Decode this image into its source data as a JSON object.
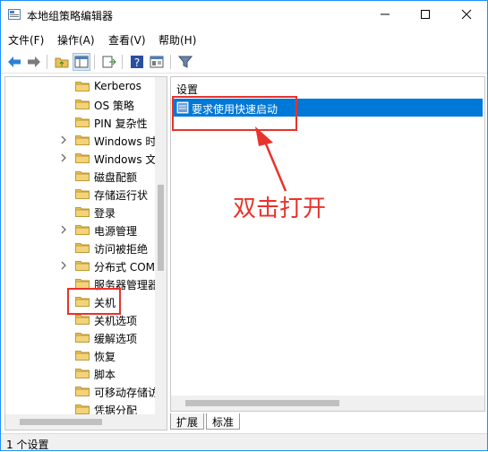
{
  "window": {
    "title": "本地组策略编辑器"
  },
  "menu": [
    "文件(F)",
    "操作(A)",
    "查看(V)",
    "帮助(H)"
  ],
  "toolbar": {
    "icons": [
      "back-arrow-icon",
      "forward-arrow-icon",
      "up-folder-icon",
      "show-hide-tree-icon",
      "export-list-icon",
      "help-icon",
      "properties-icon",
      "filter-icon"
    ]
  },
  "tree": {
    "items": [
      {
        "label": "Kerberos",
        "expandable": false
      },
      {
        "label": "OS 策略",
        "expandable": false
      },
      {
        "label": "PIN 复杂性",
        "expandable": false
      },
      {
        "label": "Windows 时",
        "expandable": true
      },
      {
        "label": "Windows 文",
        "expandable": true
      },
      {
        "label": "磁盘配额",
        "expandable": false
      },
      {
        "label": "存储运行状",
        "expandable": false
      },
      {
        "label": "登录",
        "expandable": false
      },
      {
        "label": "电源管理",
        "expandable": true
      },
      {
        "label": "访问被拒绝",
        "expandable": false
      },
      {
        "label": "分布式 COM",
        "expandable": true
      },
      {
        "label": "服务器管理器",
        "expandable": false
      },
      {
        "label": "关机",
        "expandable": false,
        "selected": true
      },
      {
        "label": "关机选项",
        "expandable": false
      },
      {
        "label": "缓解选项",
        "expandable": false
      },
      {
        "label": "恢复",
        "expandable": false
      },
      {
        "label": "脚本",
        "expandable": false
      },
      {
        "label": "可移动存储访",
        "expandable": false
      },
      {
        "label": "凭据分配",
        "expandable": false
      }
    ]
  },
  "right_pane": {
    "column_header": "设置",
    "settings": [
      {
        "label": "要求使用快速启动",
        "selected": true
      }
    ]
  },
  "tabs": [
    "扩展",
    "标准"
  ],
  "status": {
    "text": "1 个设置"
  },
  "annotation": {
    "text": "双击打开",
    "color": "#e8332b"
  },
  "colors": {
    "selection": "#0078d7",
    "folder": "#e8c15a",
    "accent_border": "#1e90ff"
  }
}
